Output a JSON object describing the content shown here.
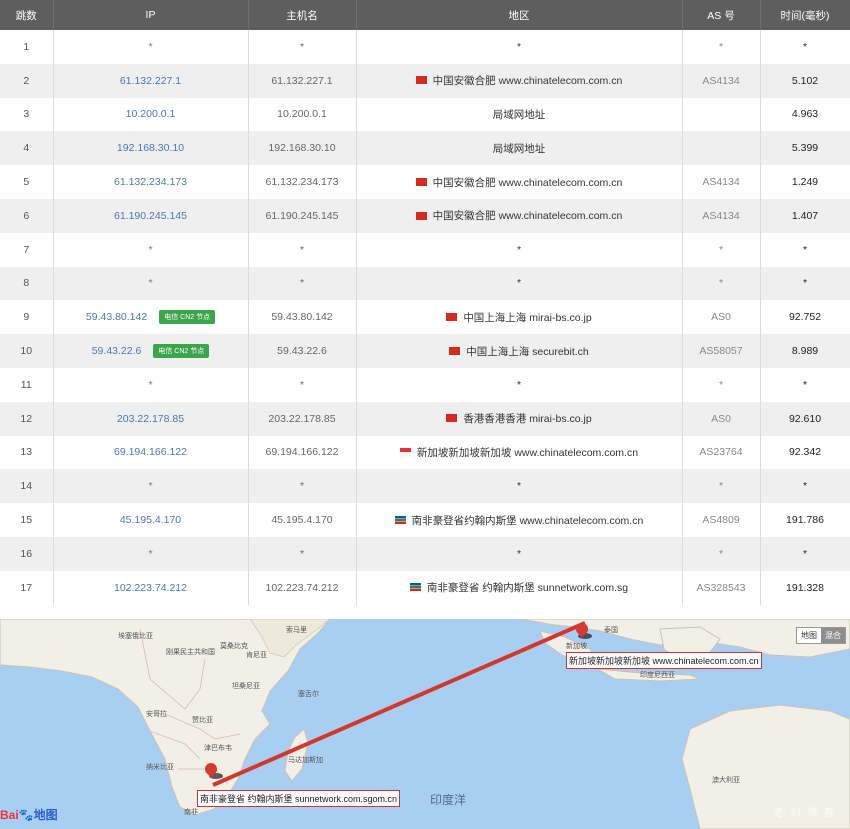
{
  "table": {
    "headers": [
      "跳数",
      "IP",
      "主机名",
      "地区",
      "AS 号",
      "时间(毫秒)"
    ],
    "cn2_badge": "电信 CN2 节点",
    "rows": [
      {
        "hop": "1",
        "ip": "*",
        "host": "*",
        "flag": "",
        "region": "*",
        "as": "*",
        "time": "*",
        "cn2": false
      },
      {
        "hop": "2",
        "ip": "61.132.227.1",
        "host": "61.132.227.1",
        "flag": "cn",
        "region": "中国安徽合肥 www.chinatelecom.com.cn",
        "as": "AS4134",
        "time": "5.102",
        "cn2": false
      },
      {
        "hop": "3",
        "ip": "10.200.0.1",
        "host": "10.200.0.1",
        "flag": "",
        "region": "局域网地址",
        "as": "",
        "time": "4.963",
        "cn2": false
      },
      {
        "hop": "4",
        "ip": "192.168.30.10",
        "host": "192.168.30.10",
        "flag": "",
        "region": "局域网地址",
        "as": "",
        "time": "5.399",
        "cn2": false
      },
      {
        "hop": "5",
        "ip": "61.132.234.173",
        "host": "61.132.234.173",
        "flag": "cn",
        "region": "中国安徽合肥 www.chinatelecom.com.cn",
        "as": "AS4134",
        "time": "1.249",
        "cn2": false
      },
      {
        "hop": "6",
        "ip": "61.190.245.145",
        "host": "61.190.245.145",
        "flag": "cn",
        "region": "中国安徽合肥 www.chinatelecom.com.cn",
        "as": "AS4134",
        "time": "1.407",
        "cn2": false
      },
      {
        "hop": "7",
        "ip": "*",
        "host": "*",
        "flag": "",
        "region": "*",
        "as": "*",
        "time": "*",
        "cn2": false
      },
      {
        "hop": "8",
        "ip": "*",
        "host": "*",
        "flag": "",
        "region": "*",
        "as": "*",
        "time": "*",
        "cn2": false
      },
      {
        "hop": "9",
        "ip": "59.43.80.142",
        "host": "59.43.80.142",
        "flag": "cn",
        "region": "中国上海上海 mirai-bs.co.jp",
        "as": "AS0",
        "time": "92.752",
        "cn2": true
      },
      {
        "hop": "10",
        "ip": "59.43.22.6",
        "host": "59.43.22.6",
        "flag": "cn",
        "region": "中国上海上海 securebit.ch",
        "as": "AS58057",
        "time": "8.989",
        "cn2": true
      },
      {
        "hop": "11",
        "ip": "*",
        "host": "*",
        "flag": "",
        "region": "*",
        "as": "*",
        "time": "*",
        "cn2": false
      },
      {
        "hop": "12",
        "ip": "203.22.178.85",
        "host": "203.22.178.85",
        "flag": "hk",
        "region": "香港香港香港 mirai-bs.co.jp",
        "as": "AS0",
        "time": "92.610",
        "cn2": false
      },
      {
        "hop": "13",
        "ip": "69.194.166.122",
        "host": "69.194.166.122",
        "flag": "sg",
        "region": "新加坡新加坡新加坡 www.chinatelecom.com.cn",
        "as": "AS23764",
        "time": "92.342",
        "cn2": false
      },
      {
        "hop": "14",
        "ip": "*",
        "host": "*",
        "flag": "",
        "region": "*",
        "as": "*",
        "time": "*",
        "cn2": false
      },
      {
        "hop": "15",
        "ip": "45.195.4.170",
        "host": "45.195.4.170",
        "flag": "za",
        "region": "南非豪登省约翰内斯堡 www.chinatelecom.com.cn",
        "as": "AS4809",
        "time": "191.786",
        "cn2": false
      },
      {
        "hop": "16",
        "ip": "*",
        "host": "*",
        "flag": "",
        "region": "*",
        "as": "*",
        "time": "*",
        "cn2": false
      },
      {
        "hop": "17",
        "ip": "102.223.74.212",
        "host": "102.223.74.212",
        "flag": "za",
        "region": "南非豪登省 约翰内斯堡 sunnetwork.com.sg",
        "as": "AS328543",
        "time": "191.328",
        "cn2": false
      }
    ]
  },
  "map": {
    "toggle": {
      "map": "地图",
      "hybrid": "混合"
    },
    "ocean": "印度洋",
    "labels": {
      "ethiopia": "埃塞俄比亚",
      "somalia": "索马里",
      "drc": "刚果民主共和国",
      "kenya": "肯尼亚",
      "tanzania": "坦桑尼亚",
      "seychelles": "塞舌尔",
      "angola": "安哥拉",
      "zambia": "赞比亚",
      "zimbabwe": "津巴布韦",
      "namibia": "纳米比亚",
      "madagascar": "马达加斯加",
      "south_africa": "南非",
      "australia": "澳大利亚",
      "indonesia": "印度尼西亚",
      "singapore": "新加坡",
      "mozambique": "莫桑比克",
      "thailand": "泰国"
    },
    "route_labels": {
      "singapore": "新加坡新加坡新加坡 www.chinatelecom.com.cn",
      "johannesburg": "南非豪登省 约翰内斯堡 sunnetwork.com.sgom.cn"
    },
    "logo_bai": "Bai",
    "logo_du": "地图",
    "watermark": "老 刘 博 客"
  }
}
